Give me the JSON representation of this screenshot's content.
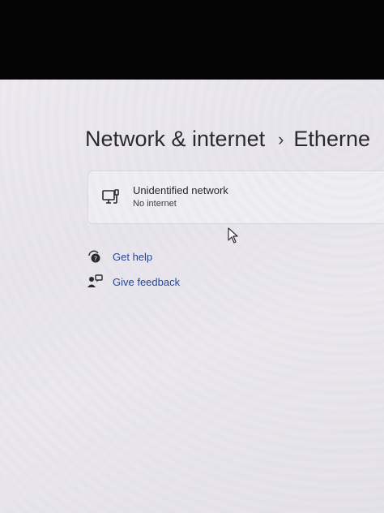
{
  "breadcrumb": {
    "parent": "Network & internet",
    "separator": "›",
    "current": "Etherne"
  },
  "network": {
    "name": "Unidentified network",
    "status": "No internet",
    "icon": "network-device-icon"
  },
  "links": {
    "get_help": "Get help",
    "give_feedback": "Give feedback"
  },
  "colors": {
    "link": "#1a3d91",
    "text": "#1f1f1f"
  }
}
